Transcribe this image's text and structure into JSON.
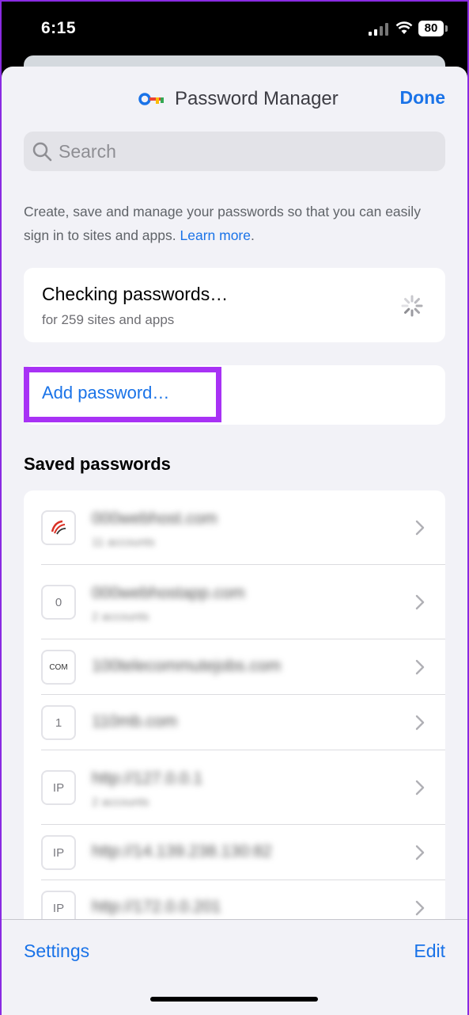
{
  "status_bar": {
    "time": "6:15",
    "battery": "80"
  },
  "nav": {
    "title": "Password Manager",
    "done_label": "Done",
    "icon": "key-icon"
  },
  "search": {
    "placeholder": "Search"
  },
  "description": {
    "text": "Create, save and manage your passwords so that you can easily sign in to sites and apps.",
    "link": "Learn more",
    "suffix": "."
  },
  "checkup": {
    "title": "Checking passwords…",
    "subtitle": "for 259 sites and apps"
  },
  "add_password": {
    "label": "Add password…"
  },
  "saved": {
    "header": "Saved passwords",
    "items": [
      {
        "icon_text": "",
        "site": "000webhost.com",
        "accounts": "11 accounts"
      },
      {
        "icon_text": "0",
        "site": "000webhostapp.com",
        "accounts": "2 accounts"
      },
      {
        "icon_text": "COM",
        "site": "100telecommutejobs.com",
        "accounts": ""
      },
      {
        "icon_text": "1",
        "site": "110mb.com",
        "accounts": ""
      },
      {
        "icon_text": "IP",
        "site": "http://127.0.0.1",
        "accounts": "2 accounts"
      },
      {
        "icon_text": "IP",
        "site": "http://14.139.238.130:82",
        "accounts": ""
      },
      {
        "icon_text": "IP",
        "site": "http://172.0.0.201",
        "accounts": ""
      }
    ]
  },
  "bottom_bar": {
    "settings_label": "Settings",
    "edit_label": "Edit"
  },
  "colors": {
    "accent": "#1a73e8",
    "highlight": "#a832f5"
  }
}
